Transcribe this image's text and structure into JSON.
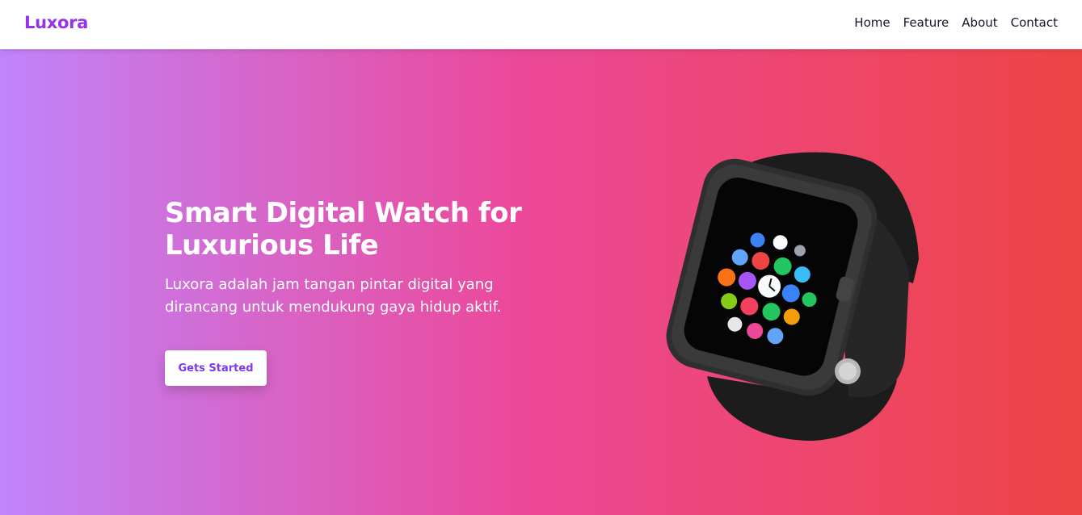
{
  "navbar": {
    "brand": "Luxora",
    "links": [
      "Home",
      "Feature",
      "About",
      "Contact"
    ]
  },
  "hero": {
    "title": "Smart Digital Watch for Luxurious Life",
    "description": "Luxora adalah jam tangan pintar digital yang dirancang untuk mendukung gaya hidup aktif.",
    "cta_label": "Gets Started",
    "image": "smartwatch-product-image"
  },
  "colors": {
    "brand": "#9333ea",
    "gradient_start": "#c084fc",
    "gradient_mid": "#ec4899",
    "gradient_end": "#ef4444",
    "button_text": "#7c3aed"
  }
}
